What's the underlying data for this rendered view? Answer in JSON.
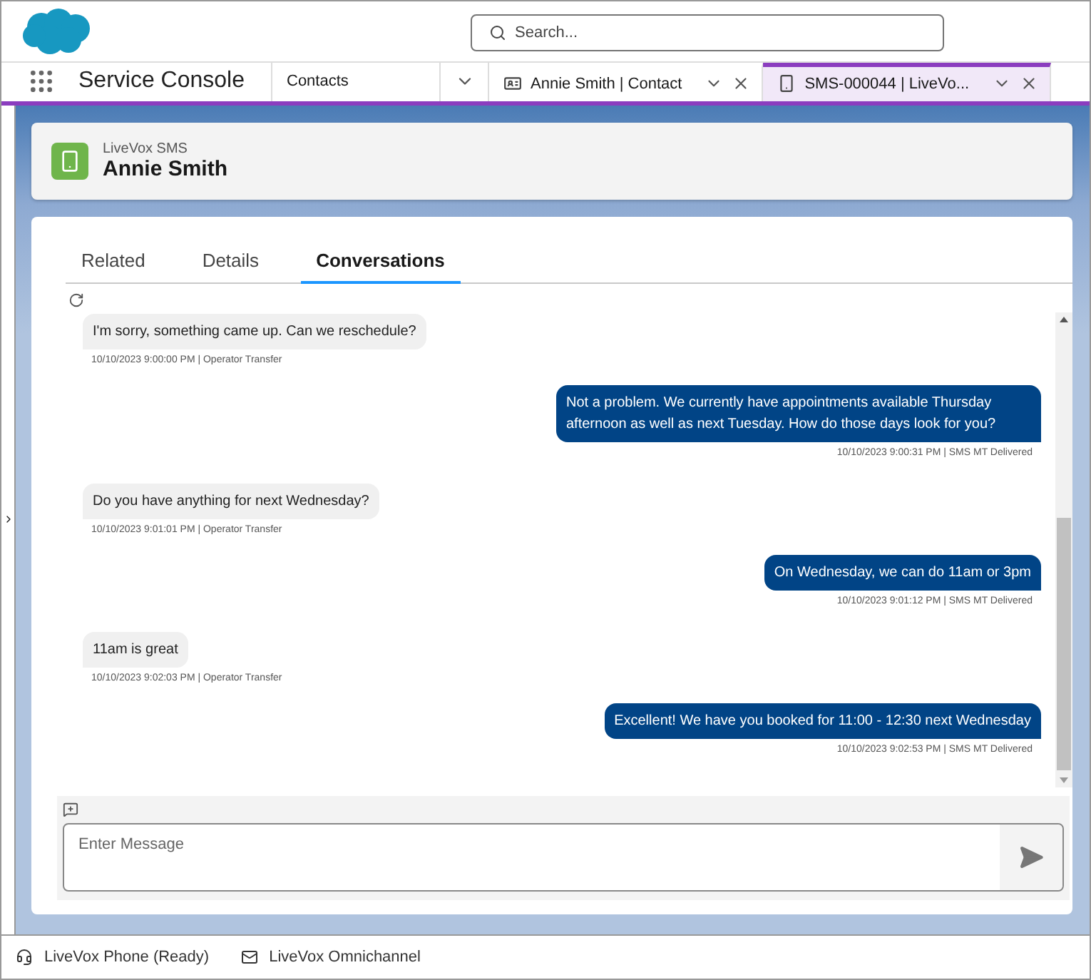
{
  "header": {
    "search": {
      "placeholder": "Search..."
    }
  },
  "nav": {
    "app_name": "Service Console",
    "object_tab": {
      "label": "Contacts"
    },
    "tabs": [
      {
        "label": "Annie Smith | Contact",
        "kind": "contact",
        "selected": false
      },
      {
        "label": "SMS-000044 | LiveVo...",
        "kind": "phone",
        "selected": true
      }
    ]
  },
  "record": {
    "type": "LiveVox SMS",
    "name": "Annie Smith"
  },
  "tabs": [
    {
      "label": "Related",
      "selected": false
    },
    {
      "label": "Details",
      "selected": false
    },
    {
      "label": "Conversations",
      "selected": true
    }
  ],
  "messages": [
    {
      "kind": "inbound",
      "text": "I'm sorry, something came up. Can we reschedule?",
      "meta": "10/10/2023 9:00:00 PM | Operator Transfer"
    },
    {
      "kind": "outbound",
      "text": "Not a problem. We currently have appointments available Thursday afternoon as well as next Tuesday. How do those days look for you?",
      "meta": "10/10/2023 9:00:31 PM | SMS MT Delivered"
    },
    {
      "kind": "inbound",
      "text": "Do you have anything for next Wednesday?",
      "meta": "10/10/2023 9:01:01 PM | Operator Transfer"
    },
    {
      "kind": "outbound",
      "text": "On Wednesday, we can do 11am or 3pm",
      "meta": "10/10/2023 9:01:12 PM | SMS MT Delivered"
    },
    {
      "kind": "inbound",
      "text": "11am is great",
      "meta": "10/10/2023 9:02:03 PM | Operator Transfer"
    },
    {
      "kind": "outbound",
      "text": "Excellent! We have you booked for 11:00 - 12:30 next Wednesday",
      "meta": "10/10/2023 9:02:53 PM | SMS MT Delivered"
    }
  ],
  "composer": {
    "placeholder": "Enter Message"
  },
  "footer": [
    {
      "kind": "phone",
      "label": "LiveVox Phone (Ready)"
    },
    {
      "kind": "mail",
      "label": "LiveVox Omnichannel"
    }
  ]
}
